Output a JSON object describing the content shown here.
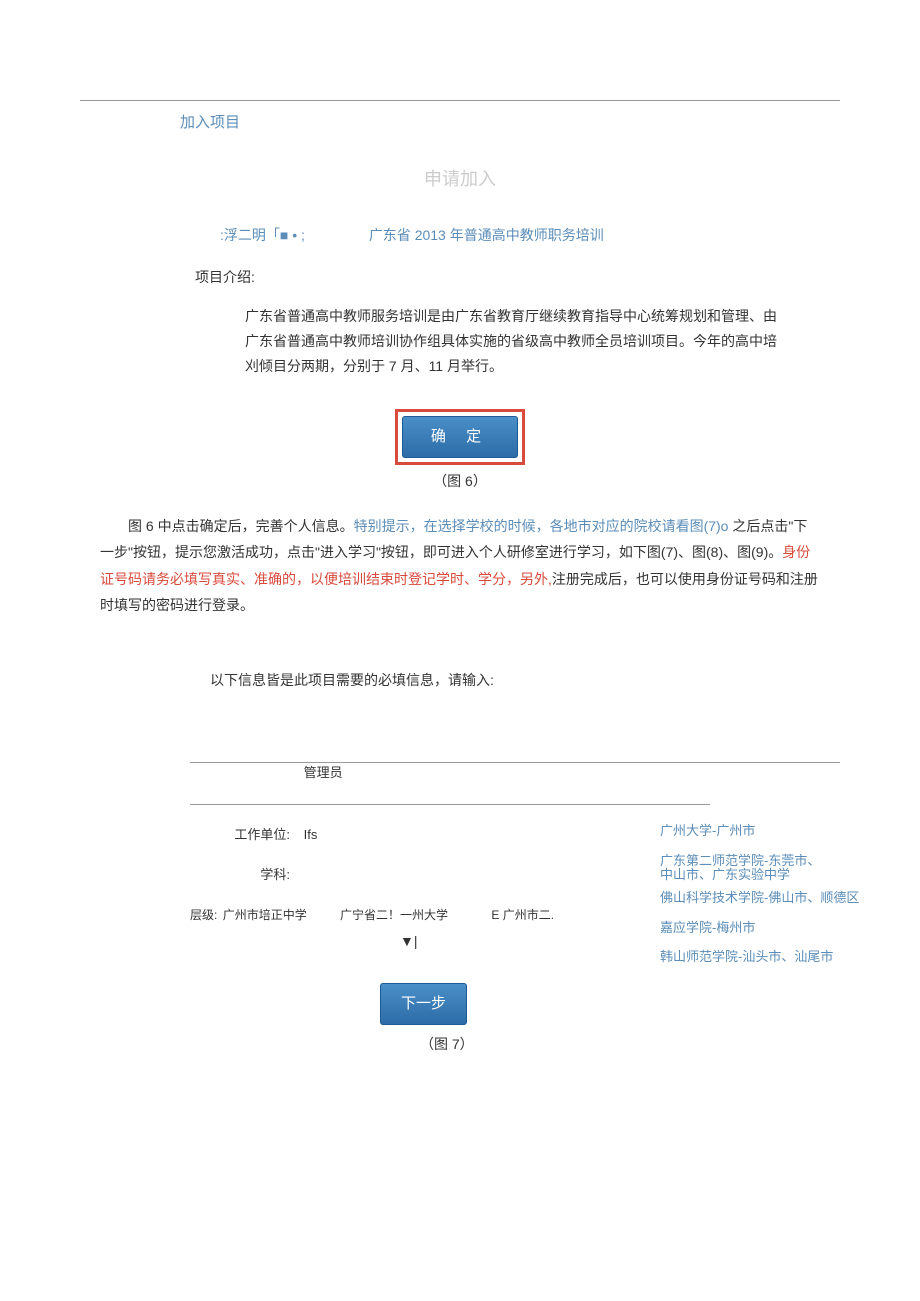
{
  "header": {
    "join_project": "加入项目",
    "apply_title": "申请加入"
  },
  "row1": {
    "left_text": ":浮二明「■ • ;",
    "project_name": "广东省 2013 年普通高中教师职务培训"
  },
  "intro": {
    "label": "项目介绍:",
    "text": "广东省普通高中教师服务培训是由广东省教育厅继续教育指导中心统筹规划和管理、由广东省普通高中教师培训协作组具体实施的省级高中教师全员培训项目。今年的高中培刈倾目分两期，分别于 7 月、11 月举行。"
  },
  "buttons": {
    "confirm": "确  定",
    "next": "下一步"
  },
  "captions": {
    "fig6": "（图 6）",
    "fig7": "（图 7）"
  },
  "main_para": {
    "p1a": "图 6 中点击确定后，完善个人信息。",
    "p1b_blue": "特别提示，在选择学校的时候，各地市对应的院校请看图(7)o ",
    "p1c": "之后点击\"下一步\"按钮，提示您激活成功，点击\"进入学习\"按钮，即可进入个人研修室进行学习，如下图(7)、图(8)、图(9)。",
    "p1d_red": "身份证号码请务必填写真实、准确的，以便培训结束时登记学时、学分，另外,",
    "p1e": "注册完成后，也可以使用身份证号码和注册时填写的密码进行登录。"
  },
  "form": {
    "intro": "以下信息皆是此项目需要的必填信息，请输入:",
    "admin_label": "管理员",
    "work_unit_label": "工作单位:",
    "work_unit_value": "Ifs",
    "subject_label": "学科:",
    "level_label": "层级:",
    "level_v1": "广州市培正中学",
    "level_v2": "广宁省二！一州大学",
    "level_v3": "E 广州市二.",
    "dropdown": "▼|"
  },
  "schools": {
    "s1": "广州大学-广州市",
    "s2a": "广东第二师范学院-东莞市、",
    "s2b": "中山市、广东实验中学",
    "s3": "佛山科学技术学院-佛山市、顺德区",
    "s4": "嘉应学院-梅州市",
    "s5": "韩山师范学院-汕头市、汕尾市"
  }
}
